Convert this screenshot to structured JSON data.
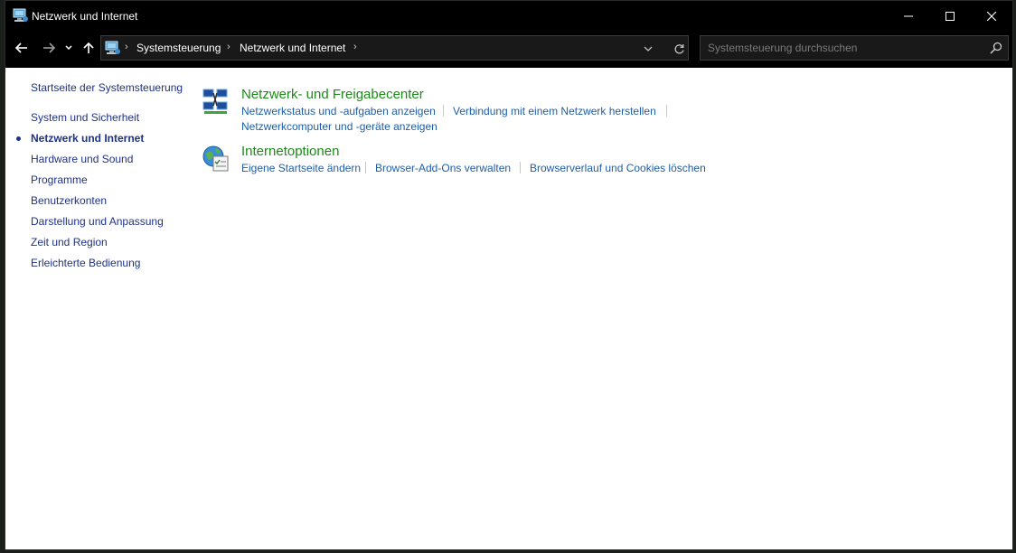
{
  "window": {
    "title": "Netzwerk und Internet"
  },
  "address_bar": {
    "items": [
      "Systemsteuerung",
      "Netzwerk und Internet"
    ]
  },
  "search": {
    "placeholder": "Systemsteuerung durchsuchen",
    "value": ""
  },
  "sidebar": {
    "home": "Startseite der Systemsteuerung",
    "items": [
      {
        "label": "System und Sicherheit",
        "current": false
      },
      {
        "label": "Netzwerk und Internet",
        "current": true
      },
      {
        "label": "Hardware und Sound",
        "current": false
      },
      {
        "label": "Programme",
        "current": false
      },
      {
        "label": "Benutzerkonten",
        "current": false
      },
      {
        "label": "Darstellung und Anpassung",
        "current": false
      },
      {
        "label": "Zeit und Region",
        "current": false
      },
      {
        "label": "Erleichterte Bedienung",
        "current": false
      }
    ]
  },
  "categories": [
    {
      "title": "Netzwerk- und Freigabecenter",
      "icon": "network-sharing-center-icon",
      "tasks": [
        "Netzwerkstatus und -aufgaben anzeigen",
        "Verbindung mit einem Netzwerk herstellen",
        "Netzwerkcomputer und -geräte anzeigen"
      ]
    },
    {
      "title": "Internetoptionen",
      "icon": "internet-options-icon",
      "tasks": [
        "Eigene Startseite ändern",
        "Browser-Add-Ons verwalten",
        "Browserverlauf und Cookies löschen"
      ]
    }
  ],
  "colors": {
    "link": "#1e5ea8",
    "category_title": "#1b8a17",
    "sidebar_link": "#1e3287",
    "chrome": "#000000"
  }
}
